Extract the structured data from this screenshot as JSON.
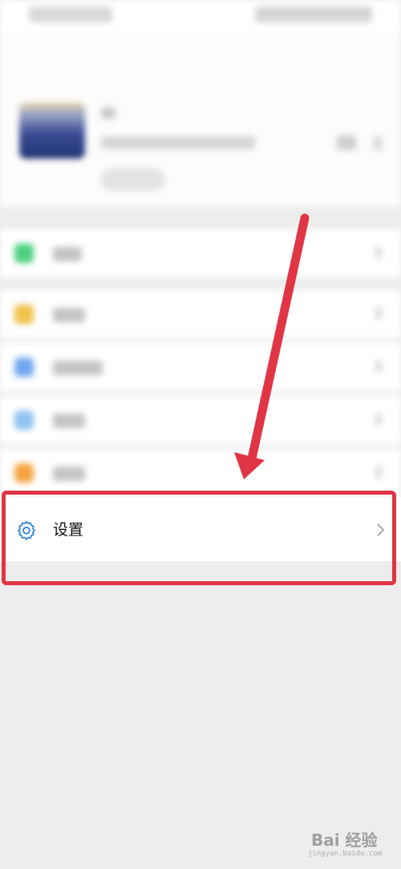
{
  "settings_row": {
    "label": "设置",
    "icon": "gear-icon",
    "icon_color": "#2f80d1"
  },
  "highlight": {
    "color": "#e03545"
  },
  "blurred_rows": [
    {
      "icon_color": "#4cd07d"
    },
    {
      "icon_color": "#f0c24a"
    },
    {
      "icon_color": "#6fa8ee"
    },
    {
      "icon_color": "#8fc4ef"
    },
    {
      "icon_color": "#f5a542"
    }
  ],
  "tabs": [
    {
      "icon": "chat-icon"
    },
    {
      "icon": "contacts-icon"
    },
    {
      "icon": "discover-icon"
    },
    {
      "icon": "me-icon",
      "active_color": "#4fc46a"
    }
  ],
  "watermark": {
    "text": "Bai 经验",
    "sub": "jingyan.baidu.com"
  }
}
